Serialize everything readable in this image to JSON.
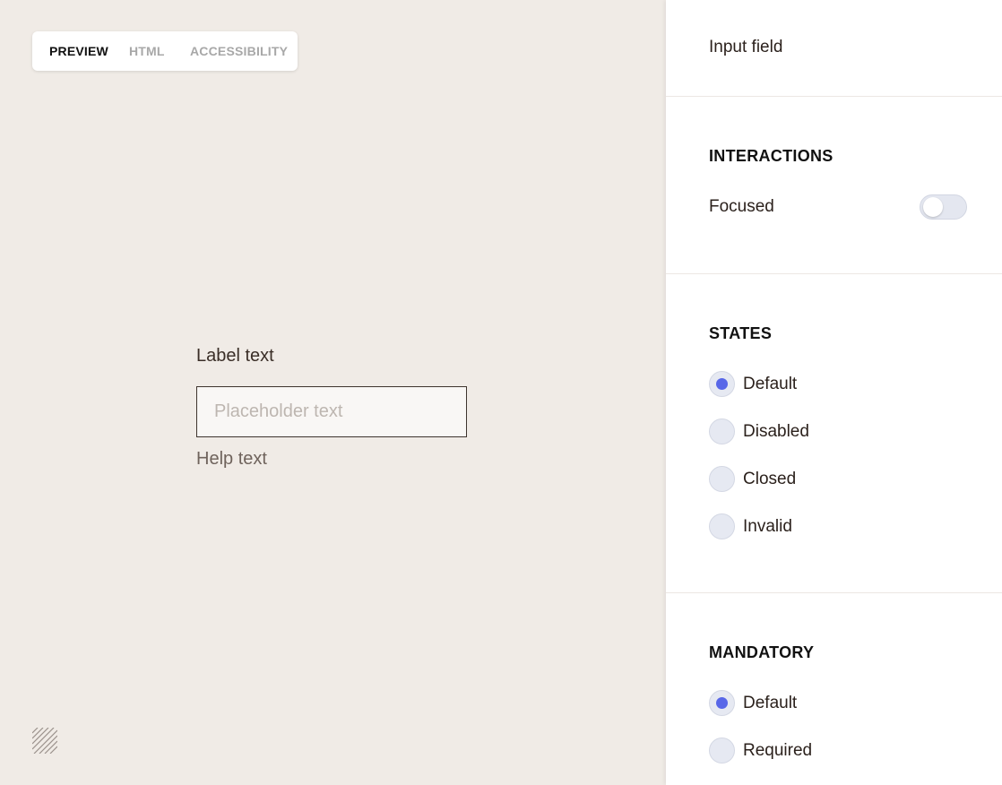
{
  "preview_tabs": [
    {
      "label": "PREVIEW",
      "active": true
    },
    {
      "label": "HTML",
      "active": false
    },
    {
      "label": "ACCESSIBILITY",
      "active": false
    }
  ],
  "field": {
    "label": "Label text",
    "placeholder": "Placeholder text",
    "value": "",
    "help": "Help text"
  },
  "panel": {
    "title": "Input field",
    "interactions": {
      "heading": "INTERACTIONS",
      "focused_label": "Focused",
      "focused_on": false
    },
    "states": {
      "heading": "STATES",
      "options": [
        {
          "label": "Default",
          "checked": true
        },
        {
          "label": "Disabled",
          "checked": false
        },
        {
          "label": "Closed",
          "checked": false
        },
        {
          "label": "Invalid",
          "checked": false
        }
      ]
    },
    "mandatory": {
      "heading": "MANDATORY",
      "options": [
        {
          "label": "Default",
          "checked": true
        },
        {
          "label": "Required",
          "checked": false
        }
      ]
    }
  },
  "colors": {
    "canvas": "#f0ebe6",
    "accent": "#5867e8",
    "radio_bg": "#e6e9f2"
  },
  "icons": {
    "bottom_left": "diagonal-stripes-icon"
  }
}
